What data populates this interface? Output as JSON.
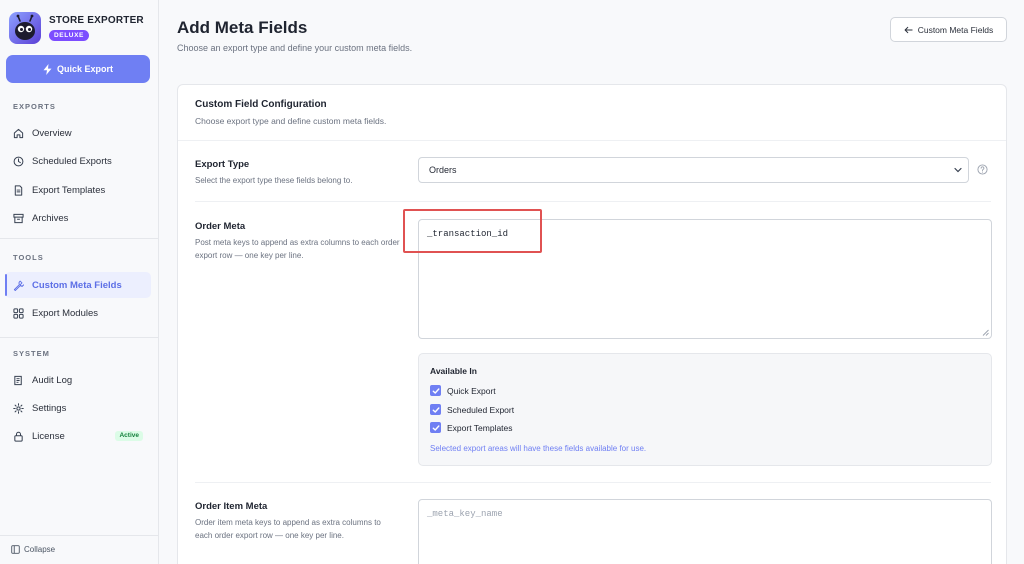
{
  "brand": {
    "name": "STORE EXPORTER",
    "badge": "DELUXE"
  },
  "sidebar": {
    "quick_export": "Quick Export",
    "sections": {
      "exports": "EXPORTS",
      "tools": "TOOLS",
      "system": "SYSTEM"
    },
    "items": {
      "overview": "Overview",
      "scheduled_exports": "Scheduled Exports",
      "export_templates": "Export Templates",
      "archives": "Archives",
      "custom_meta_fields": "Custom Meta Fields",
      "export_modules": "Export Modules",
      "audit_log": "Audit Log",
      "settings": "Settings",
      "license": "License"
    },
    "license_badge": "Active",
    "collapse": "Collapse"
  },
  "header": {
    "title": "Add Meta Fields",
    "subtitle": "Choose an export type and define your custom meta fields.",
    "back_button": "Custom Meta Fields"
  },
  "card": {
    "title": "Custom Field Configuration",
    "description": "Choose export type and define custom meta fields.",
    "export_type": {
      "label": "Export Type",
      "help": "Select the export type these fields belong to.",
      "value": "Orders"
    },
    "order_meta": {
      "label": "Order Meta",
      "help": "Post meta keys to append as extra columns to each order export row — one key per line.",
      "value": "_transaction_id"
    },
    "available_in": {
      "title": "Available In",
      "options": [
        "Quick Export",
        "Scheduled Export",
        "Export Templates"
      ],
      "note": "Selected export areas will have these fields available for use."
    },
    "order_item_meta": {
      "label": "Order Item Meta",
      "help": "Order item meta keys to append as extra columns to each order export row — one key per line.",
      "placeholder": "_meta_key_name"
    }
  },
  "colors": {
    "accent": "#6f7ff3",
    "highlight": "#e05252",
    "active_badge_bg": "#dcfce7",
    "active_badge_text": "#15803d"
  }
}
